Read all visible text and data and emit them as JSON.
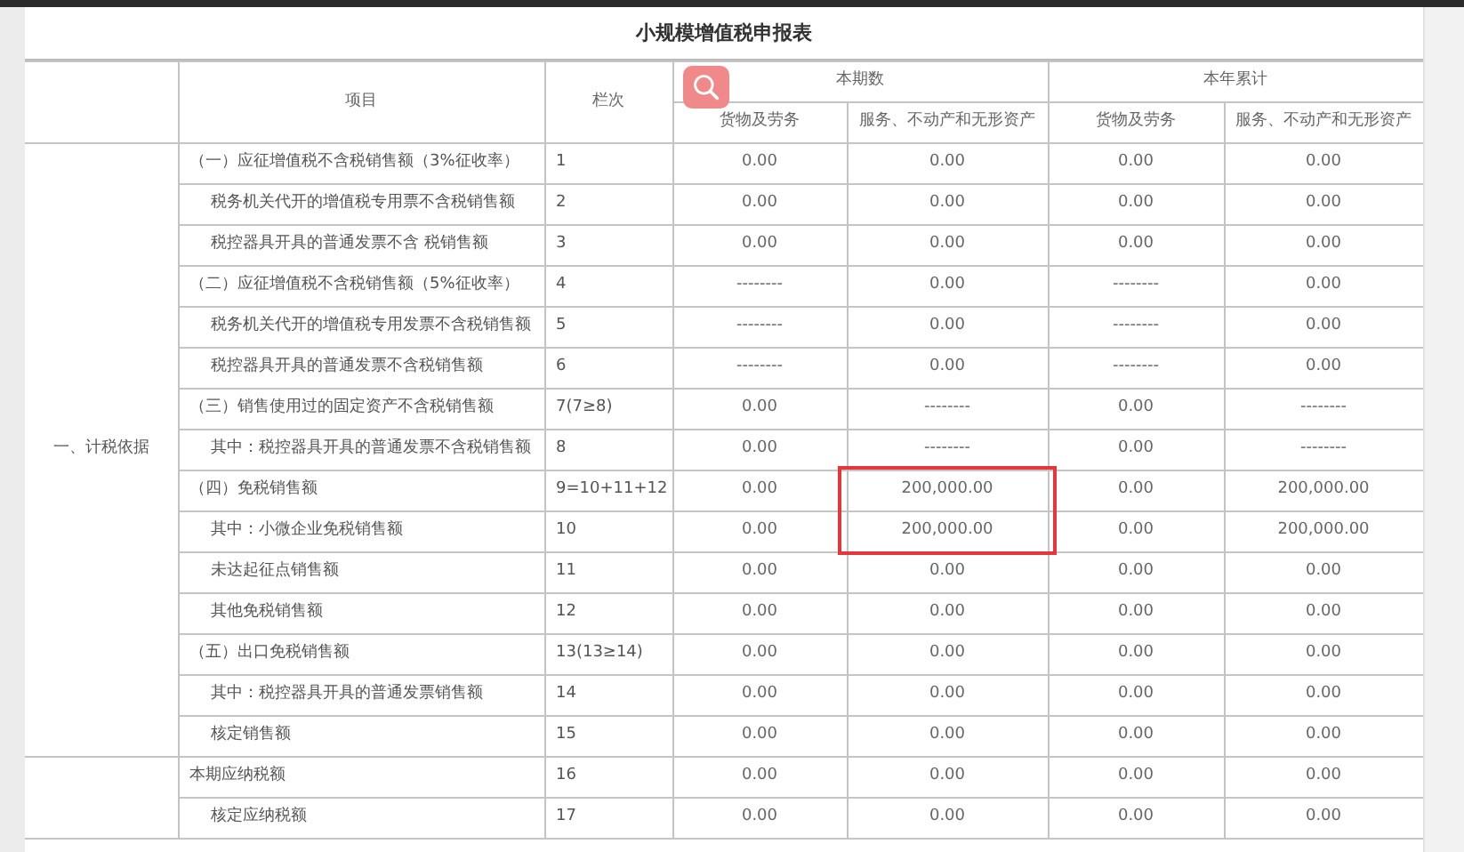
{
  "title": "小规模增值税申报表",
  "header": {
    "item": "项目",
    "line": "栏次",
    "groups": [
      {
        "label": "本期数",
        "columns": [
          "货物及劳务",
          "服务、不动产和无形资产"
        ]
      },
      {
        "label": "本年累计",
        "columns": [
          "货物及劳务",
          "服务、不动产和无形资产"
        ]
      }
    ]
  },
  "sections": [
    {
      "label": "一、计税依据",
      "items": [
        {
          "item": "（一）应征增值税不含税销售额（3%征收率）",
          "line": "1",
          "values": [
            "0.00",
            "0.00",
            "0.00",
            "0.00"
          ],
          "highlighted": false,
          "children": [
            {
              "item": "税务机关代开的增值税专用票不含税销售额",
              "line": "2",
              "values": [
                "0.00",
                "0.00",
                "0.00",
                "0.00"
              ],
              "highlighted": false
            },
            {
              "item": "税控器具开具的普通发票不含 税销售额",
              "line": "3",
              "values": [
                "0.00",
                "0.00",
                "0.00",
                "0.00"
              ],
              "highlighted": false
            }
          ]
        },
        {
          "item": "（二）应征增值税不含税销售额（5%征收率）",
          "line": "4",
          "values": [
            "--------",
            "0.00",
            "--------",
            "0.00"
          ],
          "highlighted": false,
          "children": [
            {
              "item": "税务机关代开的增值税专用发票不含税销售额",
              "line": "5",
              "values": [
                "--------",
                "0.00",
                "--------",
                "0.00"
              ],
              "highlighted": false
            },
            {
              "item": "税控器具开具的普通发票不含税销售额",
              "line": "6",
              "values": [
                "--------",
                "0.00",
                "--------",
                "0.00"
              ],
              "highlighted": false
            }
          ]
        },
        {
          "item": "（三）销售使用过的固定资产不含税销售额",
          "line": "7(7≥8)",
          "values": [
            "0.00",
            "--------",
            "0.00",
            "--------"
          ],
          "highlighted": false,
          "children": [
            {
              "item": "其中：税控器具开具的普通发票不含税销售额",
              "line": "8",
              "values": [
                "0.00",
                "--------",
                "0.00",
                "--------"
              ],
              "highlighted": false
            }
          ]
        },
        {
          "item": "（四）免税销售额",
          "line": "9=10+11+12",
          "values": [
            "0.00",
            "200,000.00",
            "0.00",
            "200,000.00"
          ],
          "highlighted": true,
          "children": [
            {
              "item": "其中：小微企业免税销售额",
              "line": "10",
              "values": [
                "0.00",
                "200,000.00",
                "0.00",
                "200,000.00"
              ],
              "highlighted": true
            },
            {
              "item": "未达起征点销售额",
              "line": "11",
              "values": [
                "0.00",
                "0.00",
                "0.00",
                "0.00"
              ],
              "highlighted": false
            },
            {
              "item": "其他免税销售额",
              "line": "12",
              "values": [
                "0.00",
                "0.00",
                "0.00",
                "0.00"
              ],
              "highlighted": false
            }
          ]
        },
        {
          "item": "（五）出口免税销售额",
          "line": "13(13≥14)",
          "values": [
            "0.00",
            "0.00",
            "0.00",
            "0.00"
          ],
          "highlighted": false,
          "children": [
            {
              "item": "其中：税控器具开具的普通发票销售额",
              "line": "14",
              "values": [
                "0.00",
                "0.00",
                "0.00",
                "0.00"
              ],
              "highlighted": false
            },
            {
              "item": "核定销售额",
              "line": "15",
              "values": [
                "0.00",
                "0.00",
                "0.00",
                "0.00"
              ],
              "highlighted": false
            }
          ]
        }
      ]
    },
    {
      "items": [
        {
          "item": "本期应纳税额",
          "line": "16",
          "values": [
            "0.00",
            "0.00",
            "0.00",
            "0.00"
          ],
          "highlighted": false,
          "children": [
            {
              "item": "核定应纳税额",
              "line": "17",
              "values": [
                "0.00",
                "0.00",
                "0.00",
                "0.00"
              ],
              "highlighted": false
            }
          ]
        }
      ]
    }
  ]
}
